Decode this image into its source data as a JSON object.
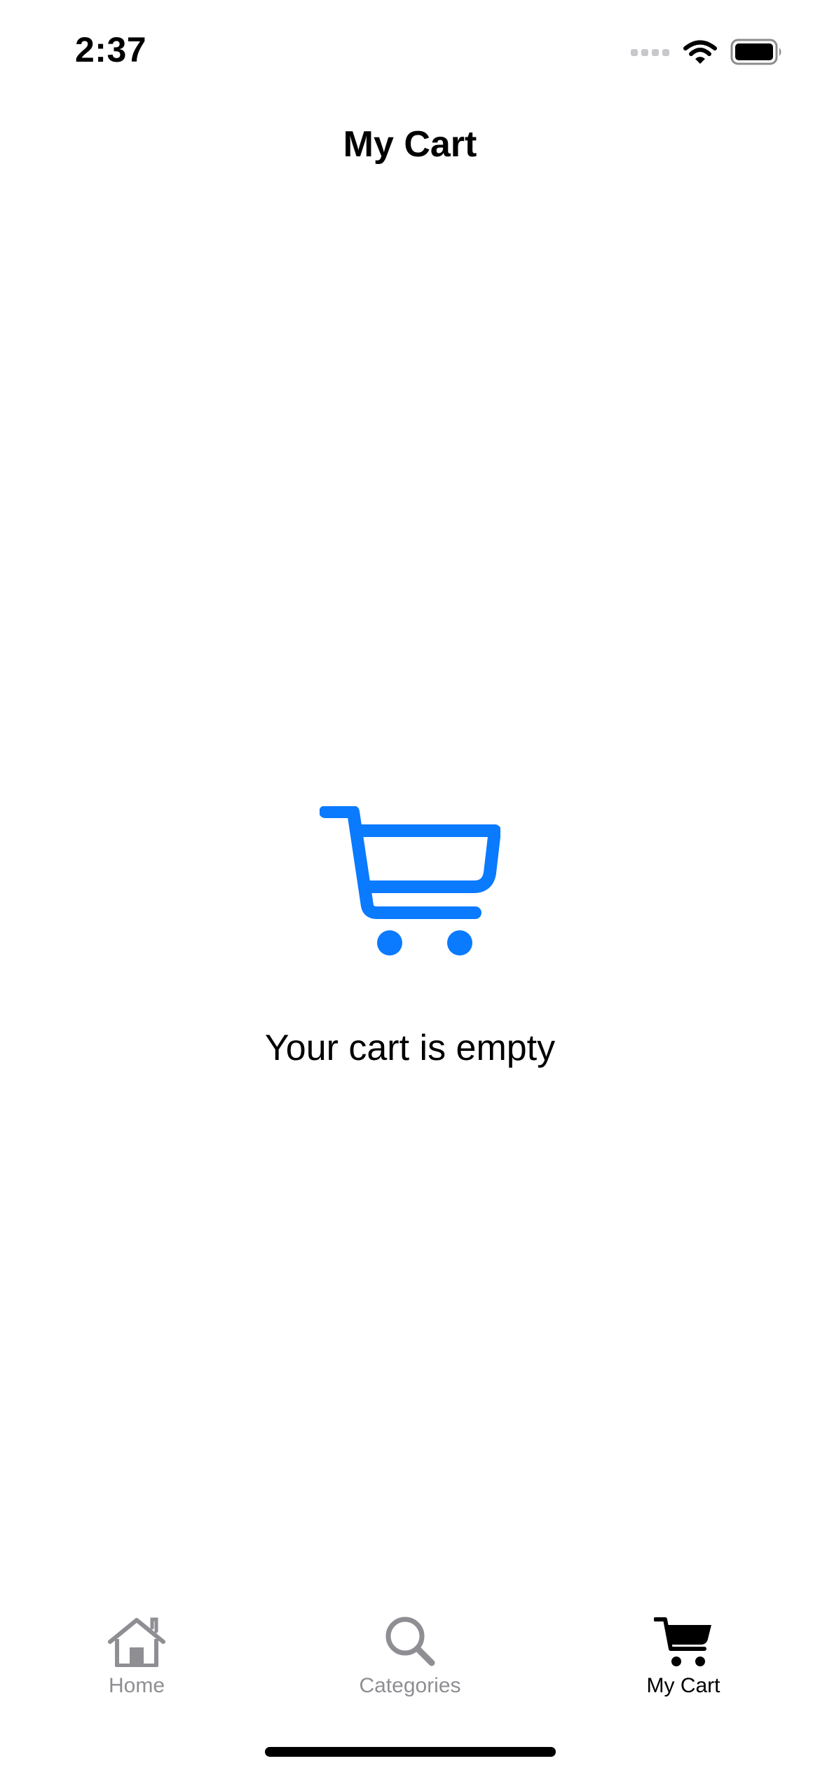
{
  "status_bar": {
    "time": "2:37",
    "icons": [
      "cellular-signal-icon",
      "wifi-icon",
      "battery-icon"
    ]
  },
  "nav": {
    "title": "My Cart"
  },
  "empty_state": {
    "icon": "shopping-cart-icon",
    "message": "Your cart is empty",
    "icon_color": "#0A7AFF"
  },
  "tab_bar": {
    "tabs": [
      {
        "label": "Home",
        "icon": "house-icon",
        "selected": false
      },
      {
        "label": "Categories",
        "icon": "magnifying-glass-icon",
        "selected": false
      },
      {
        "label": "My Cart",
        "icon": "cart-fill-icon",
        "selected": true
      }
    ],
    "inactive_color": "#8E8E93",
    "active_color": "#000000"
  }
}
